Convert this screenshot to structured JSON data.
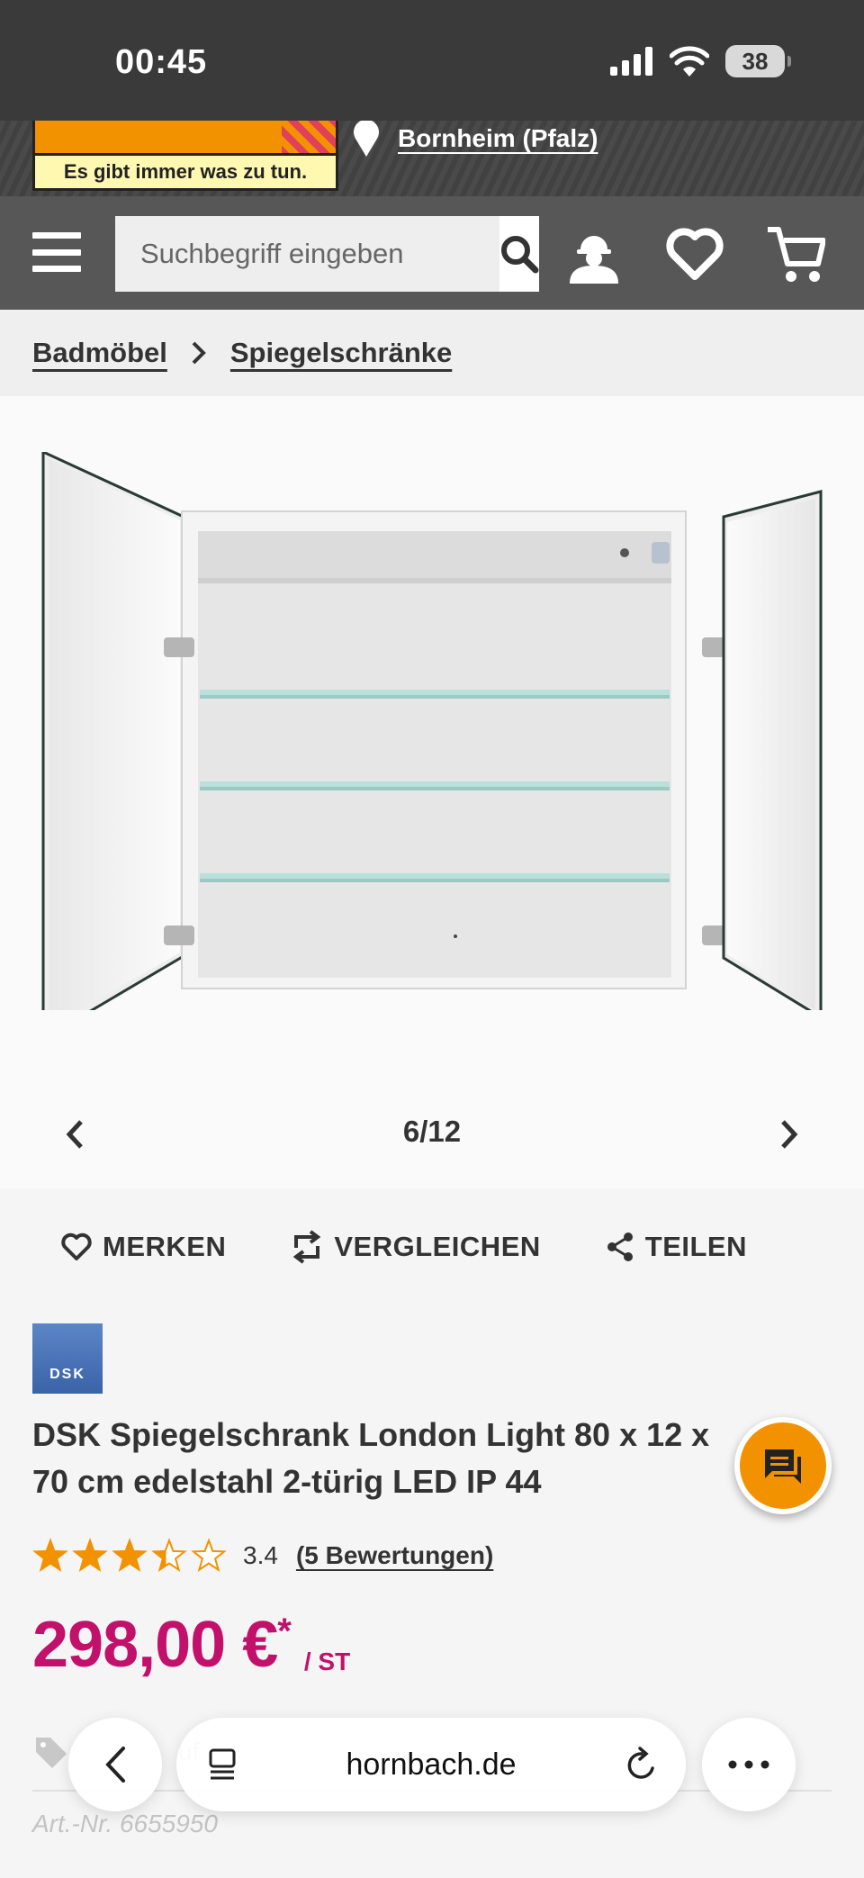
{
  "status_bar": {
    "time": "00:45",
    "battery": "38"
  },
  "store": {
    "tagline": "Es gibt immer was zu tun.",
    "location": "Bornheim (Pfalz)"
  },
  "search": {
    "placeholder": "Suchbegriff eingeben"
  },
  "breadcrumb": {
    "items": [
      "Badmöbel",
      "Spiegelschränke"
    ]
  },
  "gallery": {
    "counter": "6/12"
  },
  "actions": {
    "save": "MERKEN",
    "compare": "VERGLEICHEN",
    "share": "TEILEN"
  },
  "product": {
    "brand": "DSK",
    "title": "DSK Spiegelschrank London Light 80 x 12 x 70 cm edelstahl 2-türig LED IP 44",
    "rating": {
      "value": "3.4",
      "stars": 3.4,
      "reviews_link": "(5 Bewertungen)"
    },
    "price": {
      "value": "298,00 €",
      "star": "*",
      "unit": "/ ST"
    },
    "partial_text": "uf",
    "article_number": "Art.-Nr. 6655950"
  },
  "browser": {
    "url": "hornbach.de"
  },
  "colors": {
    "price": "#c2116b",
    "accent": "#f39200",
    "nav": "#575757"
  }
}
